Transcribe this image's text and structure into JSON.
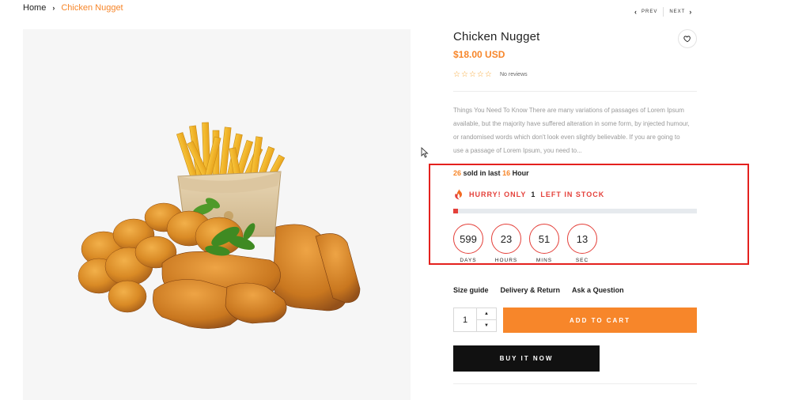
{
  "breadcrumb": {
    "home": "Home",
    "current": "Chicken Nugget"
  },
  "pager": {
    "prev": "PREV",
    "next": "NEXT"
  },
  "product": {
    "title": "Chicken Nugget",
    "price": "$18.00 USD",
    "rating_stars": 5,
    "reviews": "No reviews",
    "description": "Things You Need To Know There are many variations of passages of Lorem Ipsum available, but the majority have suffered alteration in some form, by injected humour, or randomised words which don't look even slightly believable. If you are going to use a passage of Lorem Ipsum, you need to..."
  },
  "sales": {
    "sold_count": "26",
    "sold_mid": "sold in last",
    "hours": "16",
    "hours_label": "Hour",
    "hurry_prefix": "HURRY! ONLY",
    "stock_left": "1",
    "hurry_suffix": "LEFT IN STOCK",
    "stock_fraction": 0.02
  },
  "countdown": {
    "days": "599",
    "days_label": "DAYS",
    "hours": "23",
    "hours_label": "HOURS",
    "mins": "51",
    "mins_label": "MINS",
    "secs": "13",
    "secs_label": "SEC"
  },
  "links": {
    "size_guide": "Size guide",
    "delivery": "Delivery & Return",
    "ask": "Ask a Question"
  },
  "cart": {
    "quantity": "1",
    "add_to_cart": "ADD TO CART",
    "buy_now": "BUY IT NOW"
  },
  "colors": {
    "accent": "#f7862a",
    "alert": "#e4403a",
    "highlight_box": "#e4211e"
  },
  "icons": {
    "wishlist": "heart-icon",
    "hurry": "fire-icon",
    "prev": "chevron-left-icon",
    "next": "chevron-right-icon"
  }
}
